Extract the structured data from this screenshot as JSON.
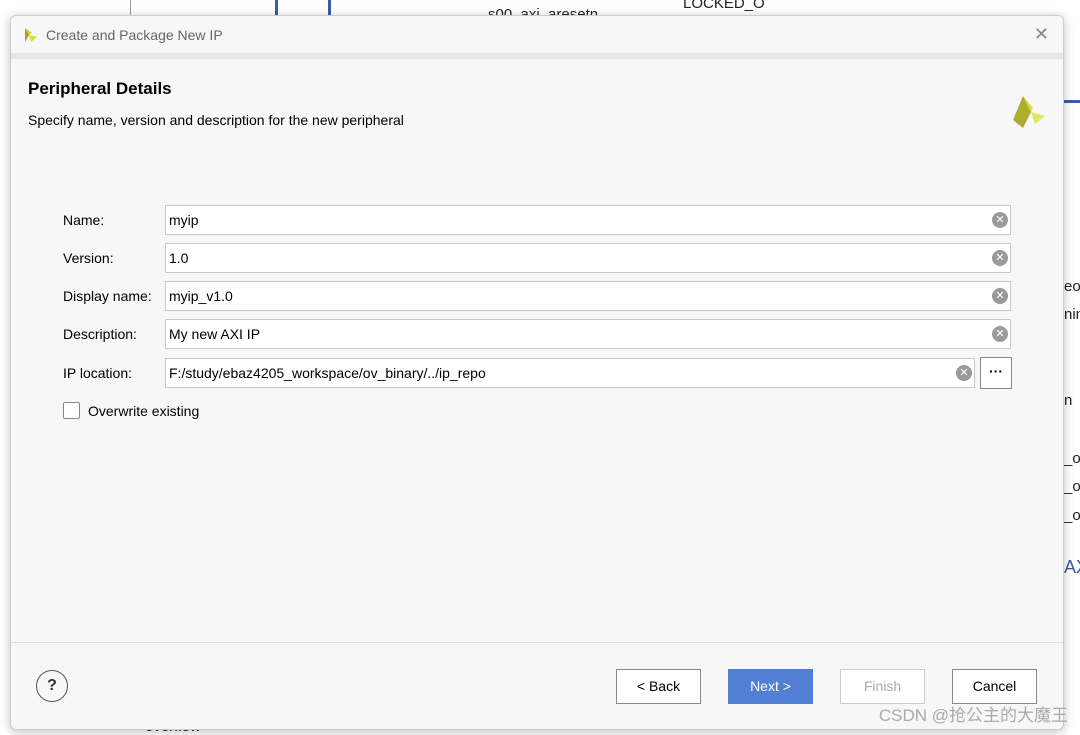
{
  "background": {
    "fragments": [
      "LOCKED_O",
      "s00_axi_aresetn",
      "eo_",
      "nin",
      "n",
      "_ou",
      "_ou",
      "_ou",
      "AX",
      "overflow"
    ]
  },
  "dialog": {
    "title": "Create and Package New IP",
    "heading": "Peripheral Details",
    "subtitle": "Specify name, version and description for the new peripheral"
  },
  "fields": [
    {
      "label": "Name:",
      "value": "myip"
    },
    {
      "label": "Version:",
      "value": "1.0"
    },
    {
      "label": "Display name:",
      "value": "myip_v1.0"
    },
    {
      "label": "Description:",
      "value": "My new AXI IP"
    },
    {
      "label": "IP location:",
      "value": "F:/study/ebaz4205_workspace/ov_binary/../ip_repo"
    }
  ],
  "overwrite": {
    "label": "Overwrite existing",
    "checked": false
  },
  "buttons": {
    "help": "?",
    "back": "< Back",
    "next": "Next >",
    "finish": "Finish",
    "cancel": "Cancel",
    "browse": "···"
  },
  "watermark": "CSDN @抢公主的大魔王",
  "colors": {
    "accent": "#527fd3"
  }
}
